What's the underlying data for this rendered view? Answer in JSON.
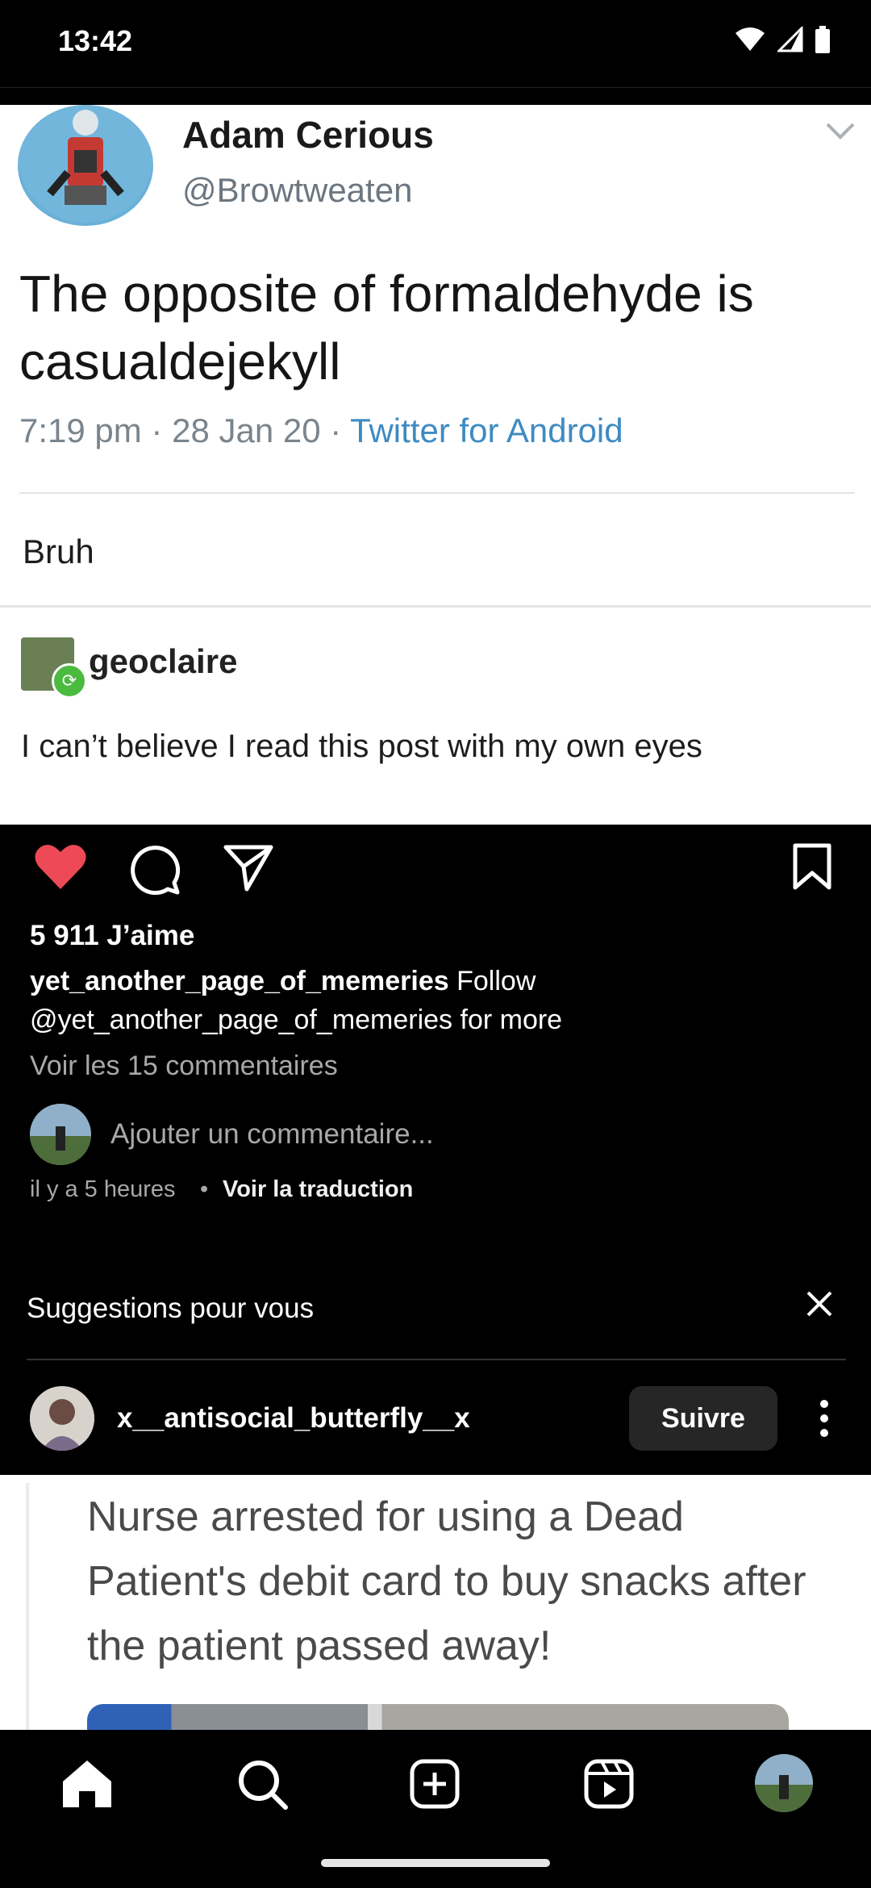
{
  "status_bar": {
    "time": "13:42"
  },
  "tweet": {
    "author_name": "Adam Cerious",
    "author_handle": "@Browtweaten",
    "text": "The opposite of formaldehyde is casualdejekyll",
    "meta_time": "7:19 pm · 28 Jan 20 · ",
    "meta_source": "Twitter for Android",
    "reply": "Bruh",
    "reblogger": "geoclaire",
    "reblog_text": "I can’t believe I read this post with my own eyes"
  },
  "post": {
    "likes": "5 911 J’aime",
    "caption_user": "yet_another_page_of_memeries",
    "caption_text": " Follow @yet_another_page_of_memeries for more",
    "view_comments": "Voir les 15 commentaires",
    "add_comment_placeholder": "Ajouter un commentaire...",
    "timestamp": "il y a 5 heures",
    "dot": "•",
    "translate": "Voir la traduction",
    "liked": true
  },
  "suggestions": {
    "title": "Suggestions pour vous",
    "account_name": "x__antisocial_butterfly__x",
    "follow_label": "Suivre"
  },
  "next_post": {
    "text": "Nurse arrested for using a Dead Patient's debit card to buy snacks after the patient passed away!"
  },
  "nav": {
    "items": [
      "home-icon",
      "search-icon",
      "create-icon",
      "reels-icon",
      "profile-avatar"
    ]
  },
  "colors": {
    "like": "#ed4956",
    "link": "#3e8bc2",
    "follow_bg": "#262626"
  }
}
